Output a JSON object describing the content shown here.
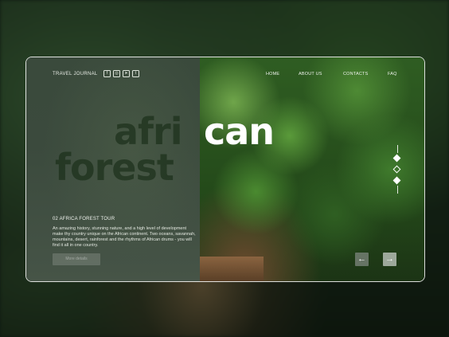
{
  "header": {
    "brand": "TRAVEL JOURNAL",
    "socials": [
      "f",
      "◎",
      "➤",
      "t"
    ],
    "social_icons": [
      "facebook-icon",
      "instagram-icon",
      "telegram-icon",
      "twitter-icon"
    ],
    "nav": [
      "HOME",
      "ABOUT US",
      "CONTACTS",
      "FAQ"
    ]
  },
  "hero": {
    "word_dark_1": "afri",
    "word_light": "can",
    "word_dark_2": "forest",
    "subtitle": "02 AFRICA FOREST TOUR",
    "description": "An amazing history, stunning nature, and a high level of development make thy country unique on the African continent. Two oceans, savannah, mountains, desert, rainforest and the rhythms of African drums - you will find it all in one country.",
    "button_label": "More details"
  },
  "pager": {
    "items": 3,
    "active_index": 1
  },
  "arrows": {
    "prev": "←",
    "next": "→"
  },
  "colors": {
    "text": "#ffffff",
    "glass": "#3b4a3d",
    "accent_button": "#b7b7b7"
  }
}
